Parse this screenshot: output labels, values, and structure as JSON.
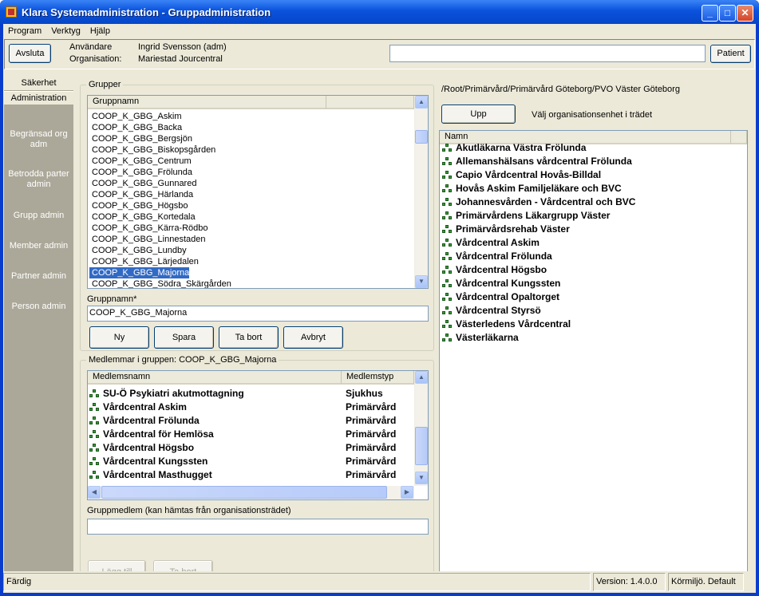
{
  "window": {
    "title": "Klara Systemadministration - Gruppadministration",
    "min": "_",
    "max": "□",
    "close": "✕"
  },
  "menu": [
    "Program",
    "Verktyg",
    "Hjälp"
  ],
  "infobar": {
    "quit": "Avsluta",
    "user_label": "Användare",
    "user_value": "Ingrid Svensson (adm)",
    "org_label": "Organisation:",
    "org_value": "Mariestad Jourcentral",
    "patient": "Patient",
    "patient_field": ""
  },
  "sidebar": {
    "tabs": [
      "Säkerhet",
      "Administration"
    ],
    "items": [
      "Begränsad org adm",
      "Betrodda parter admin",
      "Grupp admin",
      "Member admin",
      "Partner admin",
      "Person admin"
    ]
  },
  "groups": {
    "title": "Grupper",
    "column": "Gruppnamn",
    "items": [
      "COOP_K_GBG_Askim",
      "COOP_K_GBG_Backa",
      "COOP_K_GBG_Bergsjön",
      "COOP_K_GBG_Biskopsgården",
      "COOP_K_GBG_Centrum",
      "COOP_K_GBG_Frölunda",
      "COOP_K_GBG_Gunnared",
      "COOP_K_GBG_Härlanda",
      "COOP_K_GBG_Högsbo",
      "COOP_K_GBG_Kortedala",
      "COOP_K_GBG_Kärra-Rödbo",
      "COOP_K_GBG_Linnestaden",
      "COOP_K_GBG_Lundby",
      "COOP_K_GBG_Lärjedalen",
      "COOP_K_GBG_Majorna",
      "COOP_K_GBG_Södra_Skärgården"
    ],
    "selected_index": 14,
    "name_label": "Gruppnamn*",
    "name_value": "COOP_K_GBG_Majorna",
    "buttons": {
      "new": "Ny",
      "save": "Spara",
      "delete": "Ta bort",
      "cancel": "Avbryt"
    }
  },
  "members": {
    "title": "Medlemmar i gruppen: COOP_K_GBG_Majorna",
    "col_name": "Medlemsnamn",
    "col_type": "Medlemstyp",
    "rows": [
      {
        "name": "SU-Ö Psykiatri akutmottagning",
        "type": "Sjukhus"
      },
      {
        "name": "Vårdcentral Askim",
        "type": "Primärvård"
      },
      {
        "name": "Vårdcentral Frölunda",
        "type": "Primärvård"
      },
      {
        "name": "Vårdcentral för Hemlösa",
        "type": "Primärvård"
      },
      {
        "name": "Vårdcentral Högsbo",
        "type": "Primärvård"
      },
      {
        "name": "Vårdcentral Kungssten",
        "type": "Primärvård"
      },
      {
        "name": "Vårdcentral Masthugget",
        "type": "Primärvård"
      }
    ],
    "member_label": "Gruppmedlem (kan hämtas från organisationsträdet)",
    "member_value": "",
    "add": "Lägg till",
    "remove": "Ta bort"
  },
  "org": {
    "path": "/Root/Primärvård/Primärvård Göteborg/PVO Väster Göteborg",
    "up": "Upp",
    "hint": "Välj organisationsenhet i trädet",
    "column": "Namn",
    "items": [
      "Akutläkarna Västra Frölunda",
      "Allemanshälsans vårdcentral Frölunda",
      "Capio Vårdcentral Hovås-Billdal",
      "Hovås Askim Familjeläkare och BVC",
      "Johannesvården - Vårdcentral och BVC",
      "Primärvårdens Läkargrupp Väster",
      "Primärvårdsrehab Väster",
      "Vårdcentral Askim",
      "Vårdcentral Frölunda",
      "Vårdcentral Högsbo",
      "Vårdcentral Kungssten",
      "Vårdcentral Opaltorget",
      "Vårdcentral Styrsö",
      "Västerledens Vårdcentral",
      "Västerläkarna"
    ]
  },
  "status": {
    "text": "Färdig",
    "version": "Version: 1.4.0.0",
    "env": "Körmiljö. Default"
  },
  "colors": {
    "titlebar": "#0a52dc",
    "face": "#ece9d8",
    "sidebar": "#aca899",
    "selection": "#316ac5"
  }
}
